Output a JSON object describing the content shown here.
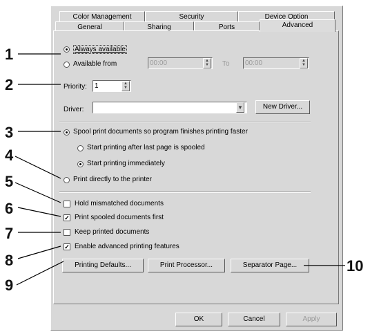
{
  "tabs_back": [
    "Color Management",
    "Security",
    "Device Option"
  ],
  "tabs_front": [
    "General",
    "Sharing",
    "Ports",
    "Advanced"
  ],
  "availability": {
    "always": "Always available",
    "from": "Available from",
    "from_time": "00:00",
    "to": "To",
    "to_time": "00:00"
  },
  "priority": {
    "label": "Priority:",
    "value": "1"
  },
  "driver": {
    "label": "Driver:",
    "value": "",
    "new_button": "New Driver..."
  },
  "spool": {
    "spool_label": "Spool print documents so program finishes printing faster",
    "after_last": "Start printing after last page is spooled",
    "immediately": "Start printing immediately",
    "direct": "Print directly to the printer"
  },
  "checks": {
    "hold": "Hold mismatched documents",
    "spooled_first": "Print spooled documents first",
    "keep": "Keep printed documents",
    "advanced": "Enable advanced printing features"
  },
  "buttons": {
    "defaults": "Printing Defaults...",
    "processor": "Print Processor...",
    "separator": "Separator Page...",
    "ok": "OK",
    "cancel": "Cancel",
    "apply": "Apply"
  },
  "callouts": [
    "1",
    "2",
    "3",
    "4",
    "5",
    "6",
    "7",
    "8",
    "9",
    "10"
  ]
}
